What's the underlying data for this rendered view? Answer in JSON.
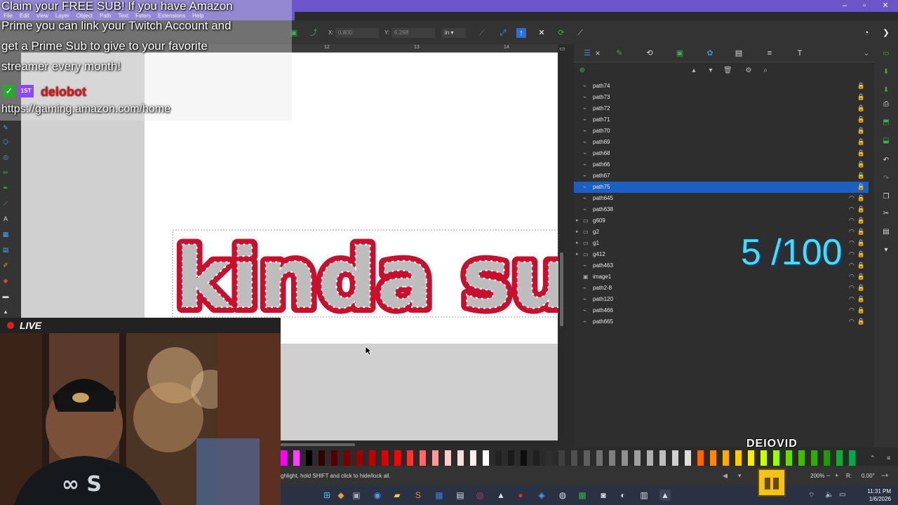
{
  "overlay": {
    "sub_line1": "Claim your FREE SUB! If you have Amazon",
    "sub_line2": "Prime you can link your Twitch Account and",
    "sub_line3": "get a Prime Sub to give to your favorite",
    "sub_line4": "streamer every month!",
    "username": "delobot",
    "badge_text": "1ST",
    "url": "https://gaming.amazon.com/home",
    "counter": "5 /100",
    "streamer_name": "DEIOVID",
    "live_label": "LIVE"
  },
  "menu": [
    "File",
    "Edit",
    "View",
    "Layer",
    "Object",
    "Path",
    "Text",
    "Filters",
    "Extensions",
    "Help"
  ],
  "toolbar": {
    "x_label": "X:",
    "x_value": "0.800",
    "y_label": "Y:",
    "y_value": "6.268",
    "unit": "in"
  },
  "ruler": {
    "ticks": [
      "12",
      "13",
      "14"
    ]
  },
  "canvas": {
    "artwork_text": "kinda sus"
  },
  "layers": [
    {
      "name": "path74",
      "type": "path",
      "selected": false,
      "eye": false
    },
    {
      "name": "path73",
      "type": "path",
      "selected": false,
      "eye": false
    },
    {
      "name": "path72",
      "type": "path",
      "selected": false,
      "eye": false
    },
    {
      "name": "path71",
      "type": "path",
      "selected": false,
      "eye": false
    },
    {
      "name": "path70",
      "type": "path",
      "selected": false,
      "eye": false
    },
    {
      "name": "path69",
      "type": "path",
      "selected": false,
      "eye": false
    },
    {
      "name": "path68",
      "type": "path",
      "selected": false,
      "eye": false
    },
    {
      "name": "path66",
      "type": "path",
      "selected": false,
      "eye": false
    },
    {
      "name": "path67",
      "type": "path",
      "selected": false,
      "eye": false
    },
    {
      "name": "path75",
      "type": "path",
      "selected": true,
      "eye": false
    },
    {
      "name": "path645",
      "type": "path",
      "selected": false,
      "eye": true
    },
    {
      "name": "path638",
      "type": "path",
      "selected": false,
      "eye": true
    },
    {
      "name": "g609",
      "type": "group",
      "selected": false,
      "eye": true
    },
    {
      "name": "g2",
      "type": "group",
      "selected": false,
      "eye": true
    },
    {
      "name": "g1",
      "type": "group",
      "selected": false,
      "eye": true
    },
    {
      "name": "g412",
      "type": "group",
      "selected": false,
      "eye": true
    },
    {
      "name": "path463",
      "type": "path",
      "selected": false,
      "eye": true
    },
    {
      "name": "image1",
      "type": "image",
      "selected": false,
      "eye": true
    },
    {
      "name": "path2-8",
      "type": "path",
      "selected": false,
      "eye": true
    },
    {
      "name": "path120",
      "type": "path",
      "selected": false,
      "eye": true
    },
    {
      "name": "path466",
      "type": "path",
      "selected": false,
      "eye": true
    },
    {
      "name": "path665",
      "type": "path",
      "selected": false,
      "eye": true
    }
  ],
  "status": {
    "hint": "ghlight, hold SHIFT and click to hide/lock all.",
    "zoom": "200%",
    "rotation_label": "R:",
    "rotation": "0.00°"
  },
  "clock": {
    "time": "11:31 PM",
    "date": "1/6/2026"
  },
  "palette_colors": [
    "#ff00ff",
    "#ff40ff",
    "#000000",
    "#330000",
    "#550000",
    "#770000",
    "#990000",
    "#bb0000",
    "#dd0000",
    "#ff0000",
    "#ff3333",
    "#ff6666",
    "#ff9999",
    "#ffcccc",
    "#ffdddd",
    "#ffeeee",
    "#ffffff",
    "#222222",
    "#1a1a1a",
    "#0d0d0d",
    "#202020",
    "#2f2f2f",
    "#3f3f3f",
    "#4f4f4f",
    "#5f5f5f",
    "#6f6f6f",
    "#7f7f7f",
    "#8f8f8f",
    "#9f9f9f",
    "#afafaf",
    "#bfbfbf",
    "#cfcfcf",
    "#dfdfdf",
    "#ff6600",
    "#ff8800",
    "#ffaa00",
    "#ffcc00",
    "#ffee00",
    "#ccff00",
    "#99ff00",
    "#66dd00",
    "#44bb00",
    "#33aa00",
    "#229900",
    "#11aa33",
    "#00aa44"
  ],
  "colors": {
    "title_bar": "#6a56c8",
    "selection": "#1b5fc2",
    "counter": "#46e0ec",
    "username": "#e01010",
    "artwork_fill": "#c8102e",
    "artwork_letters": "#bdbdbd"
  }
}
